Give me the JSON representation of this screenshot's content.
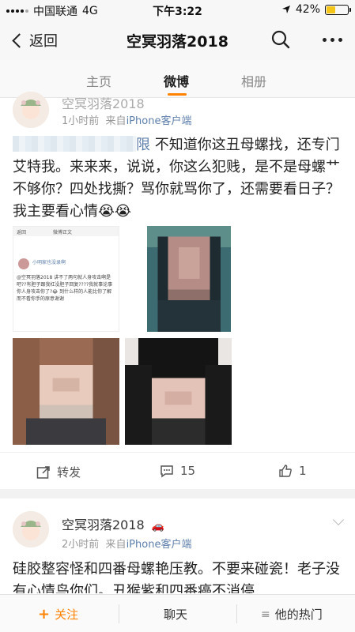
{
  "status_bar": {
    "carrier": "中国联通",
    "network": "4G",
    "time": "下午3:22",
    "battery": "42%",
    "battery_level": 0.42
  },
  "navbar": {
    "back_label": "返回",
    "title": "空冥羽落2018"
  },
  "tabs": [
    {
      "label": "主页"
    },
    {
      "label": "微博"
    },
    {
      "label": "相册"
    }
  ],
  "post1": {
    "author": "空冥羽落2018",
    "time": "1小时前",
    "source_prefix": "来自",
    "source": "iPhone客户端",
    "text": "不知道你这丑母螺找，还专门艾特我。来来来，说说，你这么犯贱，是不是母螺艹不够你？四处找撕？骂你就骂你了，还需要看日子？我主要看心情😭😭",
    "embedded": {
      "back": "返回",
      "title": "微博正文",
      "user": "小明家也没录啊",
      "body": "@空冥羽落2018 讲不了两句就人身攻击啊是吧??有胆子跟我杠没胆子回复????我就事论事你人身攻击你了?😂 到什么样的人能比你了解 而不看你手的原意谢谢"
    },
    "repost_label": "转发",
    "comment_count": "15",
    "like_count": "1"
  },
  "post2": {
    "author": "空冥羽落2018",
    "time": "2小时前",
    "source_prefix": "来自",
    "source": "iPhone客户端",
    "text": "硅胶整容怪和四番母螺艳压教。不要来碰瓷！老子没有心情鸟你们。丑猴紫和四番癌不消停"
  },
  "bottom_bar": {
    "follow": "关注",
    "chat": "聊天",
    "hot": "他的热门"
  },
  "colors": {
    "accent": "#ff8200",
    "link": "#5d7fab"
  }
}
